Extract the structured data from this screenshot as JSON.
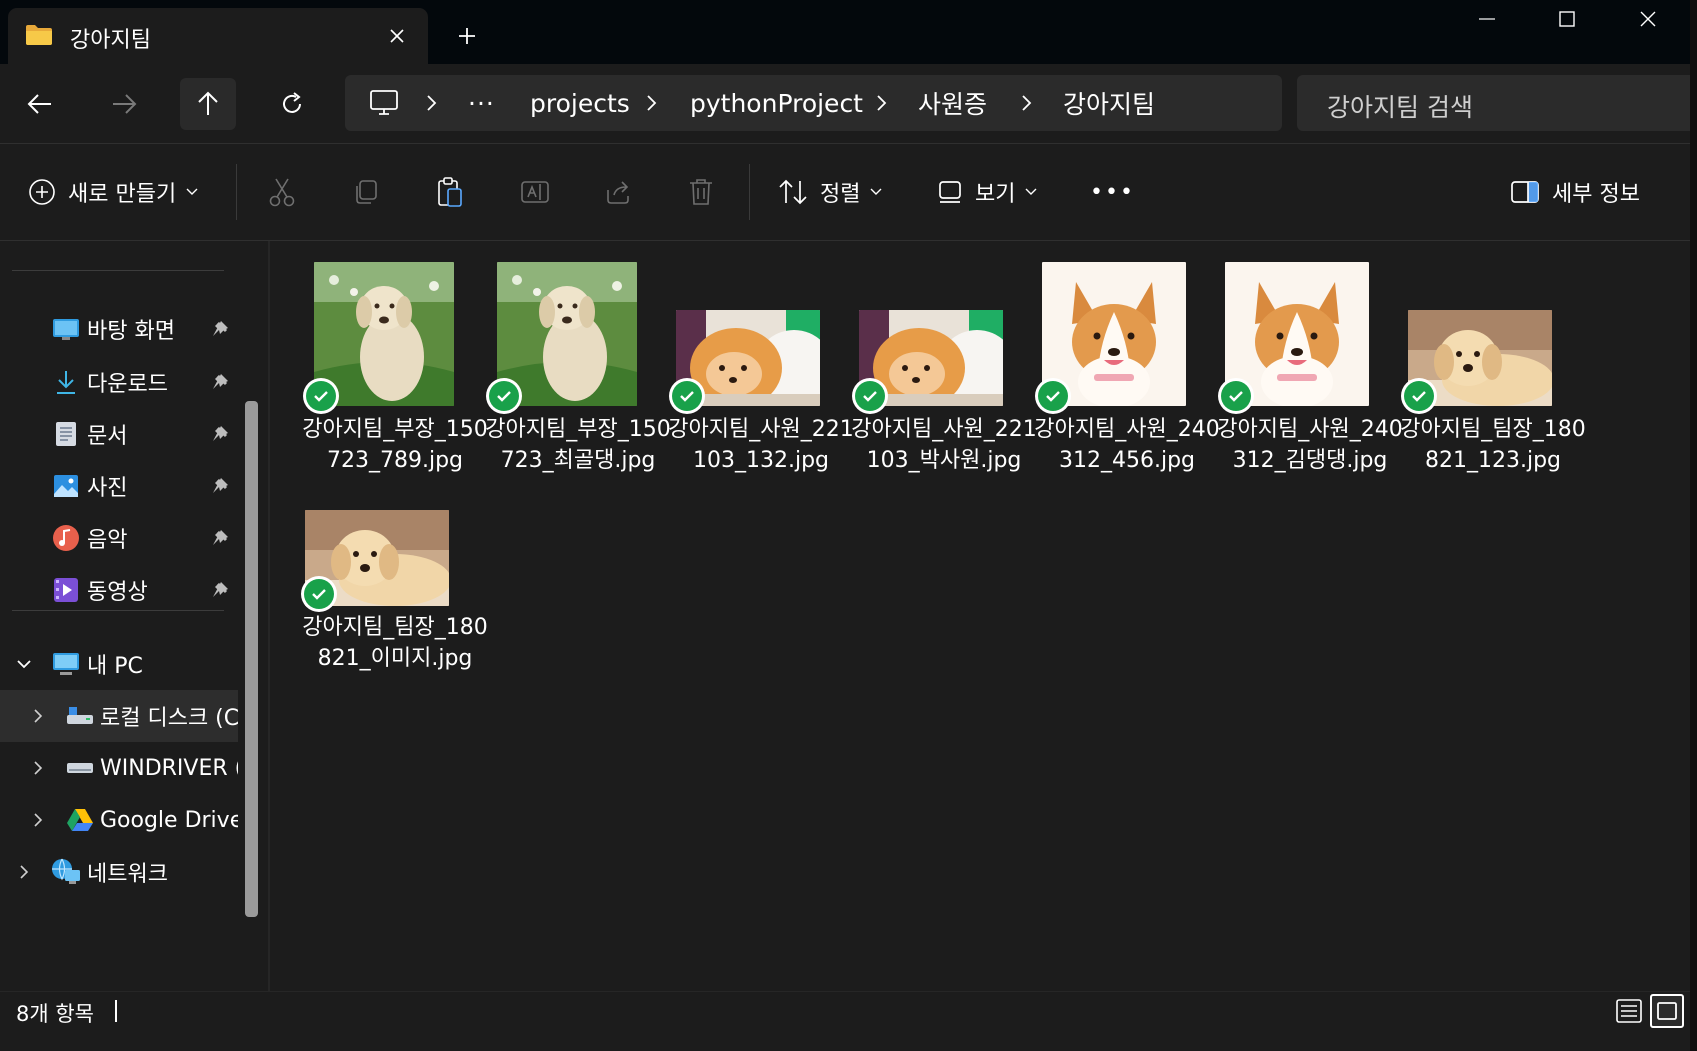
{
  "tab": {
    "title": "강아지팀",
    "close_icon": "close-icon",
    "folder_icon": "folder-icon"
  },
  "window": {
    "minimize": "minimize-icon",
    "maximize": "maximize-icon",
    "close": "close-icon"
  },
  "nav": {
    "back": "back-arrow-icon",
    "forward": "forward-arrow-icon",
    "up": "up-arrow-icon",
    "refresh": "refresh-icon",
    "breadcrumb": [
      "projects",
      "pythonProject",
      "사원증",
      "강아지팀"
    ],
    "ellipsis": "···",
    "search_placeholder": "강아지팀 검색"
  },
  "toolbar": {
    "new_label": "새로 만들기",
    "sort_label": "정렬",
    "view_label": "보기",
    "more_label": "•••",
    "details_label": "세부 정보"
  },
  "sidebar": {
    "quick_access": [
      {
        "label": "바탕 화면",
        "icon": "desktop-icon"
      },
      {
        "label": "다운로드",
        "icon": "download-icon"
      },
      {
        "label": "문서",
        "icon": "documents-icon"
      },
      {
        "label": "사진",
        "icon": "pictures-icon"
      },
      {
        "label": "음악",
        "icon": "music-icon"
      },
      {
        "label": "동영상",
        "icon": "videos-icon"
      }
    ],
    "this_pc": "내 PC",
    "drives": [
      {
        "label": "로컬 디스크 (C",
        "icon": "local-disk-icon"
      },
      {
        "label": "WINDRIVER (D",
        "icon": "drive-icon"
      },
      {
        "label": "Google Drive (",
        "icon": "google-drive-icon"
      }
    ],
    "network": "네트워크"
  },
  "files": [
    {
      "name": "강아지팀_부장_150723_789.jpg",
      "thumb": "labrador-sitting"
    },
    {
      "name": "강아지팀_부장_150723_최골댕.jpg",
      "thumb": "labrador-sitting"
    },
    {
      "name": "강아지팀_사원_221103_132.jpg",
      "thumb": "pomeranian"
    },
    {
      "name": "강아지팀_사원_221103_박사원.jpg",
      "thumb": "pomeranian"
    },
    {
      "name": "강아지팀_사원_240312_456.jpg",
      "thumb": "corgi"
    },
    {
      "name": "강아지팀_사원_240312_김댕댕.jpg",
      "thumb": "corgi"
    },
    {
      "name": "강아지팀_팀장_180821_123.jpg",
      "thumb": "labrador-puppy"
    },
    {
      "name": "강아지팀_팀장_180821_이미지.jpg",
      "thumb": "labrador-puppy"
    }
  ],
  "status": {
    "count": "8개 항목"
  },
  "colors": {
    "accent": "#19a14a",
    "background": "#1c1c1c",
    "titlebar": "#03080c"
  }
}
